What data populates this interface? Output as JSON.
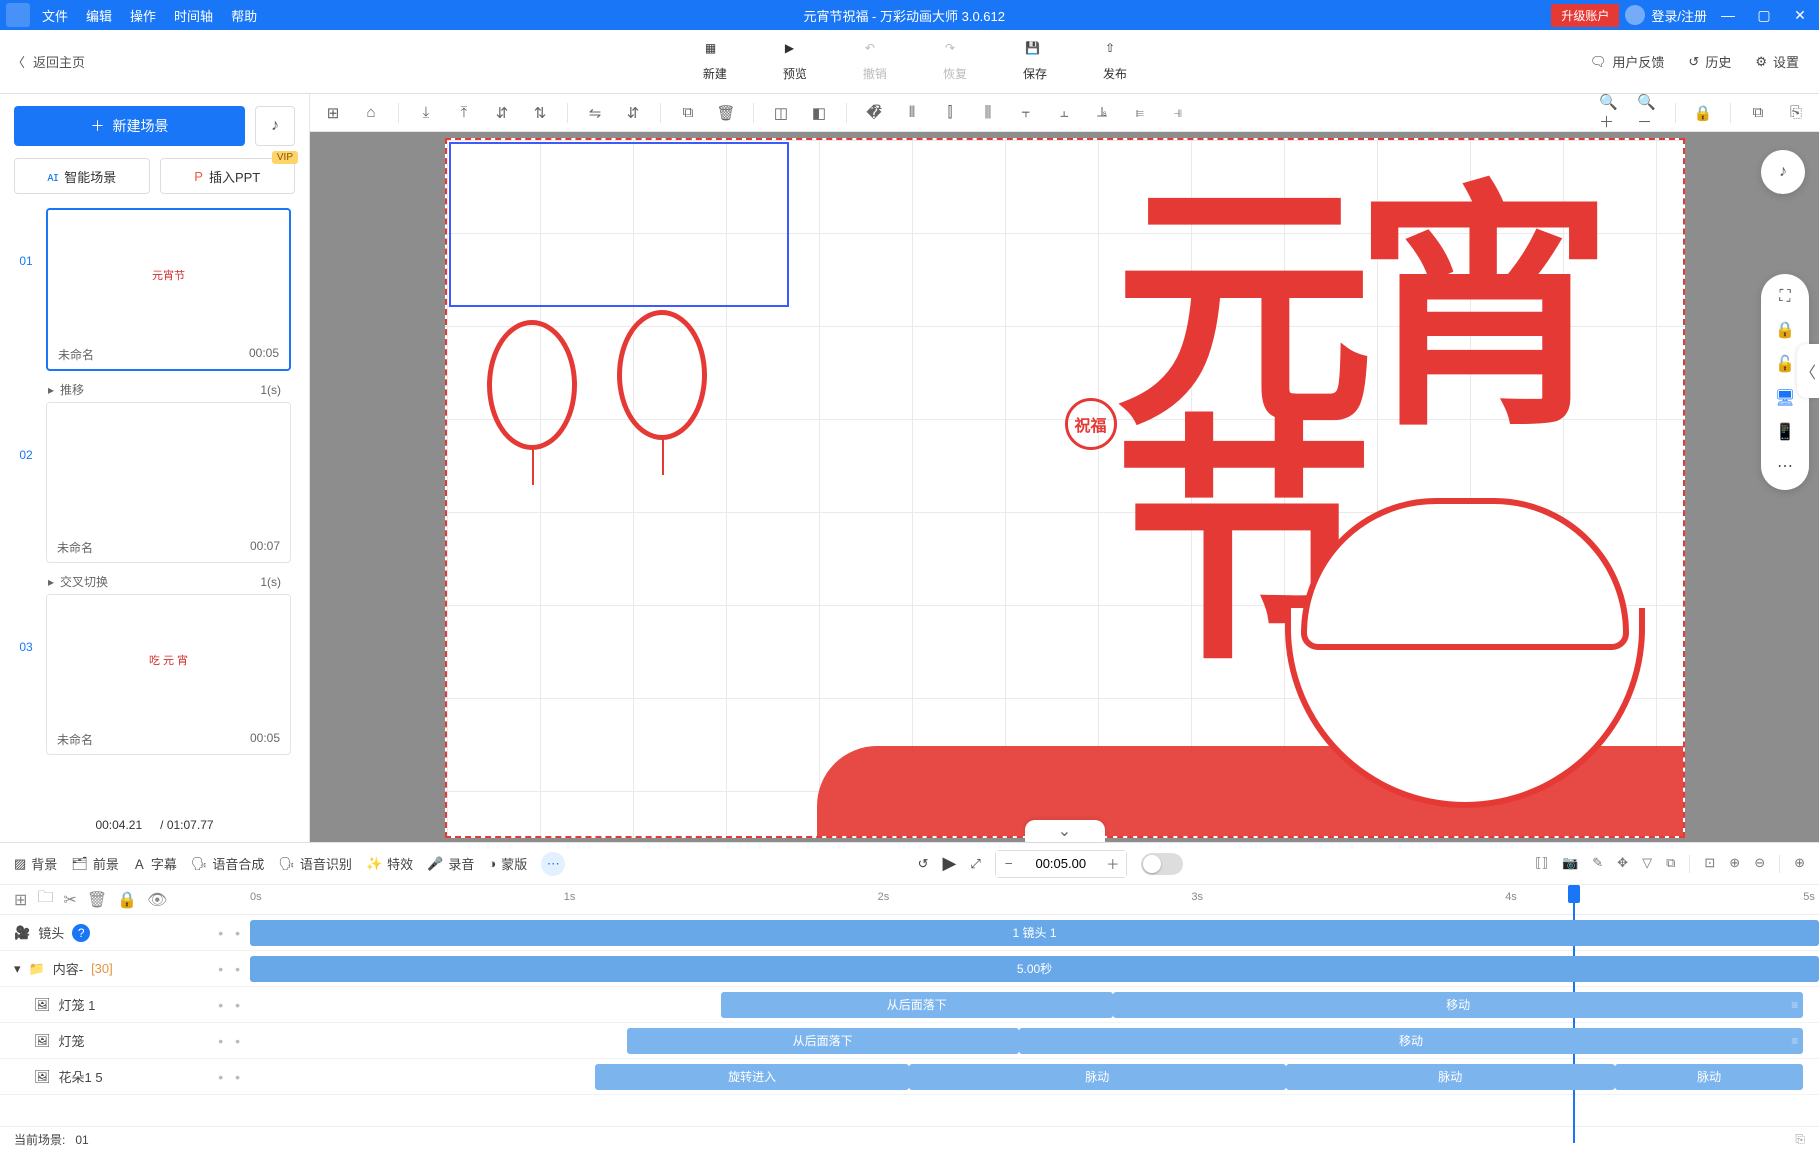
{
  "title_bar": {
    "menus": [
      "文件",
      "编辑",
      "操作",
      "时间轴",
      "帮助"
    ],
    "document_title": "元宵节祝福 - 万彩动画大师 3.0.612",
    "upgrade": "升级账户",
    "login": "登录/注册"
  },
  "action_bar": {
    "back": "返回主页",
    "buttons": {
      "new": "新建",
      "preview": "预览",
      "undo": "撤销",
      "redo": "恢复",
      "save": "保存",
      "publish": "发布"
    },
    "right": {
      "feedback": "用户反馈",
      "history": "历史",
      "settings": "设置"
    }
  },
  "scene_panel": {
    "new_scene": "新建场景",
    "smart_scene": "智能场景",
    "insert_ppt": "插入PPT",
    "vip": "VIP",
    "scenes": [
      {
        "index": "01",
        "name": "未命名",
        "duration": "00:05",
        "thumb_text": "元宵节",
        "transition": "推移",
        "transition_time": "1(s)",
        "active": true
      },
      {
        "index": "02",
        "name": "未命名",
        "duration": "00:07",
        "thumb_text": "",
        "transition": "交叉切换",
        "transition_time": "1(s)",
        "active": false
      },
      {
        "index": "03",
        "name": "未命名",
        "duration": "00:05",
        "thumb_text": "吃 元 宵",
        "transition": "",
        "transition_time": "",
        "active": false
      }
    ],
    "current_time": "00:04.21",
    "total_time": "/ 01:07.77"
  },
  "canvas": {
    "art_main": "元宵节",
    "art_sub": "祝福"
  },
  "bottom": {
    "toolbar": {
      "background": "背景",
      "foreground": "前景",
      "subtitle": "字幕",
      "tts": "语音合成",
      "asr": "语音识别",
      "effect": "特效",
      "record": "录音",
      "mask": "蒙版"
    },
    "playback_time": "00:05.00",
    "ruler_marks": [
      "0s",
      "1s",
      "2s",
      "3s",
      "4s",
      "5s"
    ],
    "tracks": {
      "camera": {
        "label": "镜头",
        "clip": "1 镜头 1"
      },
      "content": {
        "label": "内容-",
        "count": "[30]",
        "clip": "5.00秒"
      },
      "items": [
        {
          "label": "灯笼 1",
          "clips": [
            "从后面落下",
            "移动"
          ]
        },
        {
          "label": "灯笼",
          "clips": [
            "从后面落下",
            "移动"
          ]
        },
        {
          "label": "花朵1 5",
          "clips": [
            "旋转进入",
            "脉动",
            "脉动",
            "脉动"
          ]
        }
      ]
    },
    "footer": {
      "current_scene_label": "当前场景:",
      "current_scene_value": "01"
    }
  }
}
